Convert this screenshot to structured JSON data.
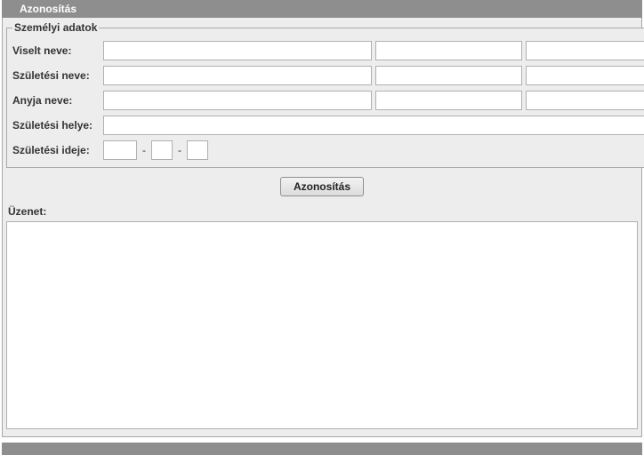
{
  "header": {
    "title": "Azonosítás"
  },
  "fieldset": {
    "legend": "Személyi adatok"
  },
  "labels": {
    "viselt_neve": "Viselt neve:",
    "szuletesi_neve": "Születési neve:",
    "anyja_neve": "Anyja neve:",
    "szuletesi_helye": "Születési helye:",
    "szuletesi_ideje": "Születési ideje:",
    "uzenet": "Üzenet:"
  },
  "fields": {
    "viselt_neve": {
      "last": "",
      "first": "",
      "middle": ""
    },
    "szuletesi_neve": {
      "last": "",
      "first": "",
      "middle": ""
    },
    "anyja_neve": {
      "last": "",
      "first": "",
      "middle": ""
    },
    "szuletesi_helye": "",
    "szuletesi_ideje": {
      "year": "",
      "month": "",
      "day": "",
      "sep": "-"
    },
    "uzenet": ""
  },
  "buttons": {
    "identify": "Azonosítás"
  }
}
